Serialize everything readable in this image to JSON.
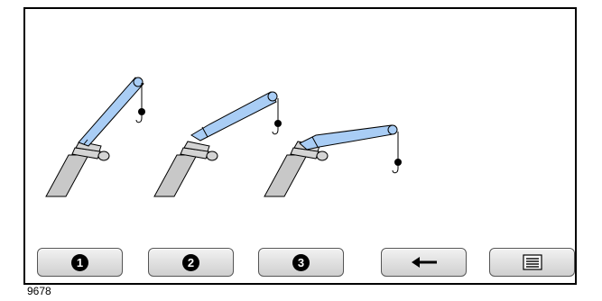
{
  "softkeys": [
    {
      "label": "1",
      "icon": "digit-1-icon"
    },
    {
      "label": "2",
      "icon": "digit-2-icon"
    },
    {
      "label": "3",
      "icon": "digit-3-icon"
    },
    {
      "icon": "arrow-left-icon"
    },
    {
      "icon": "menu-list-icon"
    }
  ],
  "footer": {
    "code": "9678"
  },
  "colors": {
    "boom": "#a9cdf5",
    "base": "#c8c8c8",
    "outline": "#000000"
  }
}
